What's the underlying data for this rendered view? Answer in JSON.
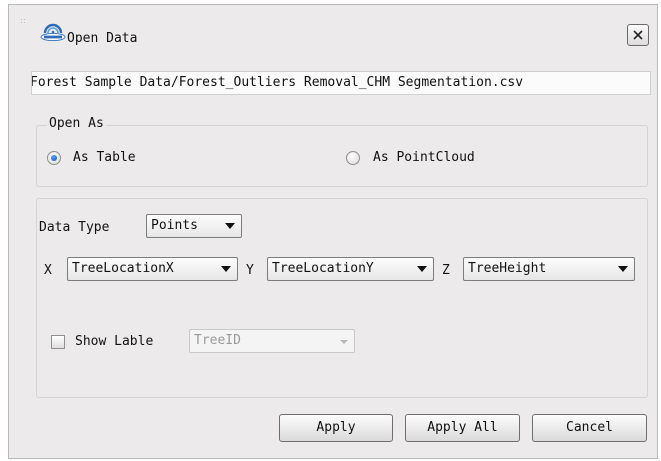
{
  "window": {
    "title": "Open Data",
    "close_icon": "close-icon",
    "logo_icon": "lidar360-logo-icon"
  },
  "file": {
    "path": "Forest Sample Data/Forest_Outliers Removal_CHM Segmentation.csv"
  },
  "open_as": {
    "legend": "Open As",
    "options": [
      {
        "label": "As Table",
        "checked": true
      },
      {
        "label": "As PointCloud",
        "checked": false
      }
    ]
  },
  "data": {
    "type_label": "Data Type",
    "type_value": "Points",
    "x_label": "X",
    "x_value": "TreeLocationX",
    "y_label": "Y",
    "y_value": "TreeLocationY",
    "z_label": "Z",
    "z_value": "TreeHeight",
    "show_label_text": "Show Lable",
    "show_label_checked": false,
    "label_field_value": "TreeID"
  },
  "buttons": {
    "apply": "Apply",
    "apply_all": "Apply All",
    "cancel": "Cancel"
  },
  "colors": {
    "dialog_bg": "#eceaea",
    "radio_selected": "#1f6fd6"
  }
}
